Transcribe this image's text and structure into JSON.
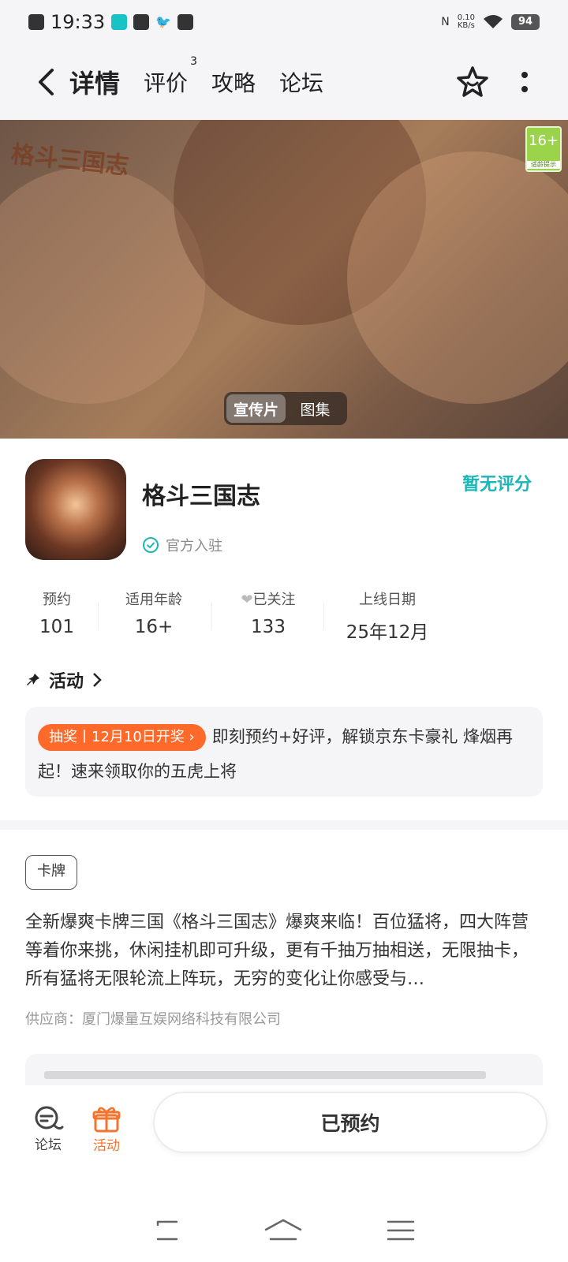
{
  "status_bar": {
    "time": "19:33",
    "network_speed": "0.10\nKB/s",
    "battery": "94"
  },
  "nav": {
    "tabs": [
      {
        "label": "详情",
        "active": true
      },
      {
        "label": "评价",
        "badge": "3"
      },
      {
        "label": "攻略"
      },
      {
        "label": "论坛"
      }
    ]
  },
  "banner": {
    "title_art": "格斗三国志",
    "age_rating": "16+",
    "age_note": "适龄提示",
    "toggle": [
      "宣传片",
      "图集"
    ]
  },
  "game": {
    "name": "格斗三国志",
    "official_label": "官方入驻",
    "rating_text": "暂无评分",
    "stats": [
      {
        "label": "预约",
        "value": "101"
      },
      {
        "label": "适用年龄",
        "value": "16+"
      },
      {
        "label": "已关注",
        "value": "133"
      },
      {
        "label": "上线日期",
        "value": "25年12月"
      }
    ]
  },
  "activity": {
    "heading": "活动",
    "badge": "抽奖丨12月10日开奖",
    "text": "即刻预约+好评，解锁京东卡豪礼 烽烟再起！速来领取你的五虎上将"
  },
  "detail": {
    "tag": "卡牌",
    "description": "全新爆爽卡牌三国《格斗三国志》爆爽来临！百位猛将，四大阵营等着你来挑，休闲挂机即可升级，更有千抽万抽相送，无限抽卡，所有猛将无限轮流上阵玩，无穷的变化让你感受与…",
    "supplier": "供应商：厦门爆量互娱网络科技有限公司"
  },
  "bottom": {
    "forum_label": "论坛",
    "activity_label": "活动",
    "reserve_label": "已预约"
  },
  "colors": {
    "accent": "#19c2c4",
    "orange": "#f2742e"
  }
}
